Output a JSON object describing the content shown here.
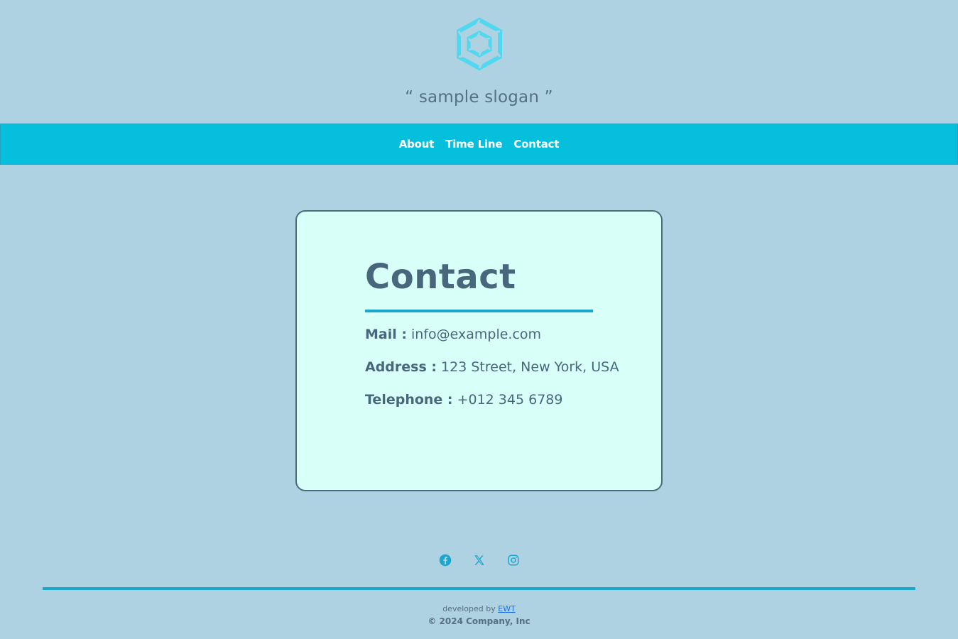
{
  "header": {
    "logo_icon": "hexagon-logo-icon",
    "slogan": "“ sample slogan ”"
  },
  "nav": {
    "items": [
      {
        "label": "About"
      },
      {
        "label": "Time Line"
      },
      {
        "label": "Contact"
      }
    ]
  },
  "contact": {
    "title": "Contact",
    "mail_label": "Mail :",
    "mail_value": "info@example.com",
    "address_label": "Address :",
    "address_value": "123 Street, New York, USA",
    "phone_label": "Telephone :",
    "phone_value": "+012 345 6789"
  },
  "footer": {
    "social_icons": [
      "facebook-icon",
      "x-icon",
      "instagram-icon"
    ],
    "developed_prefix": "developed by",
    "developer_link": "EWT",
    "copyright": "© 2024 Company, Inc"
  },
  "colors": {
    "page_bg": "#afd2e2",
    "nav_bg": "#06bfdc",
    "card_bg": "#d8fff8",
    "accent": "#1aa7cb",
    "text": "#48677d"
  }
}
